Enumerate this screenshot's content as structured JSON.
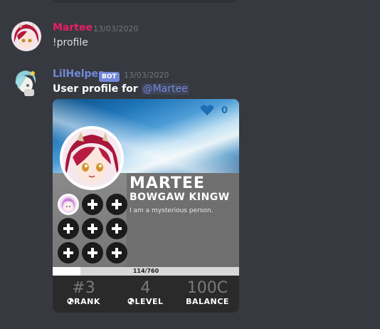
{
  "messages": [
    {
      "author": "Martee",
      "author_color": "#e91e63",
      "timestamp": "13/03/2020",
      "content": "!profile"
    },
    {
      "author": "LilHelper",
      "author_color": "#7289da",
      "bot_badge": "BOT",
      "timestamp": "13/03/2020",
      "content_prefix": "User profile for",
      "mention": "@Martee"
    }
  ],
  "profile_card": {
    "likes": "0",
    "name": "MARTEE",
    "title": "BOWGAW KINGW",
    "bio": "I am a mysterious person.",
    "xp_text": "114/760",
    "xp_progress": 0.15,
    "stats": [
      {
        "value": "#3",
        "label": "RANK",
        "icon": "globe-icon"
      },
      {
        "value": "4",
        "label": "LEVEL",
        "icon": "globe-icon"
      },
      {
        "value": "100C",
        "label": "BALANCE",
        "icon": ""
      }
    ],
    "badges": [
      "character-badge",
      "empty-badge",
      "empty-badge",
      "empty-badge",
      "empty-badge",
      "empty-badge",
      "empty-badge",
      "empty-badge",
      "empty-badge"
    ]
  }
}
